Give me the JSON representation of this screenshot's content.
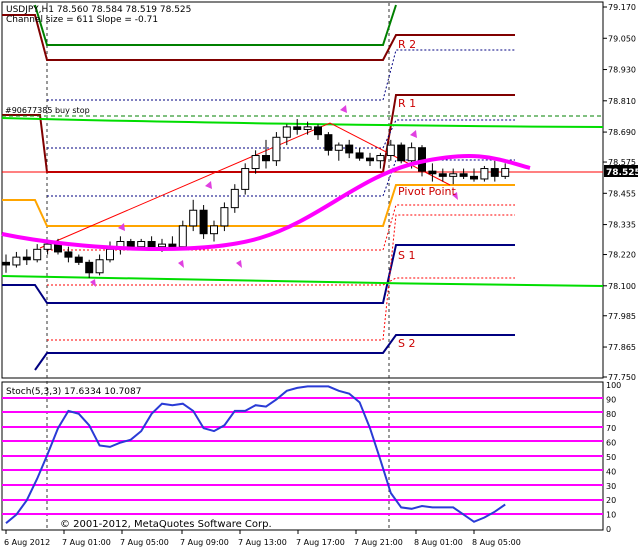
{
  "main": {
    "header_line1": "USDJPY,H1  78.560 78.584 78.519 78.525",
    "header_line2": "Channel size = 611 Slope = -0.71",
    "order_label": "#90677385 buy stop",
    "price_labels": [
      "79.170",
      "79.050",
      "78.930",
      "78.810",
      "78.690",
      "78.575",
      "78.455",
      "78.335",
      "78.220",
      "78.100",
      "77.985",
      "77.865",
      "77.750"
    ],
    "current_price": "78.525",
    "pivot_labels": {
      "r2": "R 2",
      "r1": "R 1",
      "pivot": "Pivot Point",
      "s1": "S 1",
      "s2": "S 2"
    }
  },
  "stoch": {
    "title": "Stoch(5,3,3) 17.6334 10.7087",
    "levels": [
      "100",
      "90",
      "80",
      "70",
      "60",
      "50",
      "40",
      "30",
      "20",
      "10",
      "0"
    ],
    "values": [
      4,
      10,
      20,
      35,
      52,
      70,
      82,
      80,
      72,
      58,
      57,
      60,
      62,
      68,
      80,
      87,
      86,
      87,
      82,
      70,
      68,
      72,
      82,
      82,
      86,
      85,
      90,
      96,
      98,
      99,
      99,
      99,
      96,
      94,
      88,
      70,
      48,
      25,
      15,
      14,
      16,
      15,
      15,
      15,
      10,
      5,
      8,
      12,
      17
    ]
  },
  "time_labels": [
    "6 Aug 2012",
    "7 Aug 01:00",
    "7 Aug 05:00",
    "7 Aug 09:00",
    "7 Aug 13:00",
    "7 Aug 17:00",
    "7 Aug 21:00",
    "8 Aug 01:00",
    "8 Aug 05:00"
  ],
  "copyright": "© 2001-2012, MetaQuotes Software Corp.",
  "candles": [
    {
      "o": 78.19,
      "h": 78.22,
      "l": 78.15,
      "c": 78.18
    },
    {
      "o": 78.18,
      "h": 78.23,
      "l": 78.17,
      "c": 78.21
    },
    {
      "o": 78.21,
      "h": 78.24,
      "l": 78.18,
      "c": 78.2
    },
    {
      "o": 78.2,
      "h": 78.26,
      "l": 78.19,
      "c": 78.24
    },
    {
      "o": 78.24,
      "h": 78.27,
      "l": 78.22,
      "c": 78.26
    },
    {
      "o": 78.26,
      "h": 78.28,
      "l": 78.22,
      "c": 78.23
    },
    {
      "o": 78.23,
      "h": 78.25,
      "l": 78.19,
      "c": 78.21
    },
    {
      "o": 78.21,
      "h": 78.22,
      "l": 78.18,
      "c": 78.19
    },
    {
      "o": 78.19,
      "h": 78.2,
      "l": 78.13,
      "c": 78.15
    },
    {
      "o": 78.15,
      "h": 78.22,
      "l": 78.14,
      "c": 78.2
    },
    {
      "o": 78.2,
      "h": 78.27,
      "l": 78.19,
      "c": 78.24
    },
    {
      "o": 78.24,
      "h": 78.29,
      "l": 78.22,
      "c": 78.27
    },
    {
      "o": 78.27,
      "h": 78.28,
      "l": 78.24,
      "c": 78.25
    },
    {
      "o": 78.25,
      "h": 78.28,
      "l": 78.24,
      "c": 78.27
    },
    {
      "o": 78.27,
      "h": 78.29,
      "l": 78.24,
      "c": 78.25
    },
    {
      "o": 78.25,
      "h": 78.28,
      "l": 78.23,
      "c": 78.26
    },
    {
      "o": 78.26,
      "h": 78.29,
      "l": 78.24,
      "c": 78.25
    },
    {
      "o": 78.25,
      "h": 78.35,
      "l": 78.24,
      "c": 78.33
    },
    {
      "o": 78.33,
      "h": 78.43,
      "l": 78.31,
      "c": 78.39
    },
    {
      "o": 78.39,
      "h": 78.41,
      "l": 78.28,
      "c": 78.3
    },
    {
      "o": 78.3,
      "h": 78.35,
      "l": 78.27,
      "c": 78.33
    },
    {
      "o": 78.33,
      "h": 78.42,
      "l": 78.31,
      "c": 78.4
    },
    {
      "o": 78.4,
      "h": 78.49,
      "l": 78.38,
      "c": 78.47
    },
    {
      "o": 78.47,
      "h": 78.57,
      "l": 78.45,
      "c": 78.55
    },
    {
      "o": 78.55,
      "h": 78.62,
      "l": 78.53,
      "c": 78.6
    },
    {
      "o": 78.6,
      "h": 78.66,
      "l": 78.55,
      "c": 78.58
    },
    {
      "o": 78.58,
      "h": 78.69,
      "l": 78.56,
      "c": 78.67
    },
    {
      "o": 78.67,
      "h": 78.72,
      "l": 78.64,
      "c": 78.71
    },
    {
      "o": 78.71,
      "h": 78.74,
      "l": 78.68,
      "c": 78.7
    },
    {
      "o": 78.7,
      "h": 78.73,
      "l": 78.68,
      "c": 78.71
    },
    {
      "o": 78.71,
      "h": 78.72,
      "l": 78.66,
      "c": 78.68
    },
    {
      "o": 78.68,
      "h": 78.69,
      "l": 78.6,
      "c": 78.62
    },
    {
      "o": 78.62,
      "h": 78.65,
      "l": 78.58,
      "c": 78.64
    },
    {
      "o": 78.64,
      "h": 78.66,
      "l": 78.59,
      "c": 78.61
    },
    {
      "o": 78.61,
      "h": 78.63,
      "l": 78.58,
      "c": 78.59
    },
    {
      "o": 78.59,
      "h": 78.61,
      "l": 78.56,
      "c": 78.58
    },
    {
      "o": 78.58,
      "h": 78.61,
      "l": 78.55,
      "c": 78.6
    },
    {
      "o": 78.6,
      "h": 78.66,
      "l": 78.58,
      "c": 78.64
    },
    {
      "o": 78.64,
      "h": 78.65,
      "l": 78.57,
      "c": 78.58
    },
    {
      "o": 78.58,
      "h": 78.65,
      "l": 78.55,
      "c": 78.63
    },
    {
      "o": 78.63,
      "h": 78.64,
      "l": 78.52,
      "c": 78.54
    },
    {
      "o": 78.54,
      "h": 78.57,
      "l": 78.5,
      "c": 78.53
    },
    {
      "o": 78.53,
      "h": 78.55,
      "l": 78.5,
      "c": 78.52
    },
    {
      "o": 78.52,
      "h": 78.55,
      "l": 78.49,
      "c": 78.53
    },
    {
      "o": 78.53,
      "h": 78.55,
      "l": 78.51,
      "c": 78.52
    },
    {
      "o": 78.52,
      "h": 78.55,
      "l": 78.5,
      "c": 78.51
    },
    {
      "o": 78.51,
      "h": 78.56,
      "l": 78.5,
      "c": 78.55
    },
    {
      "o": 78.55,
      "h": 78.58,
      "l": 78.5,
      "c": 78.52
    },
    {
      "o": 78.52,
      "h": 78.57,
      "l": 78.51,
      "c": 78.55
    }
  ]
}
